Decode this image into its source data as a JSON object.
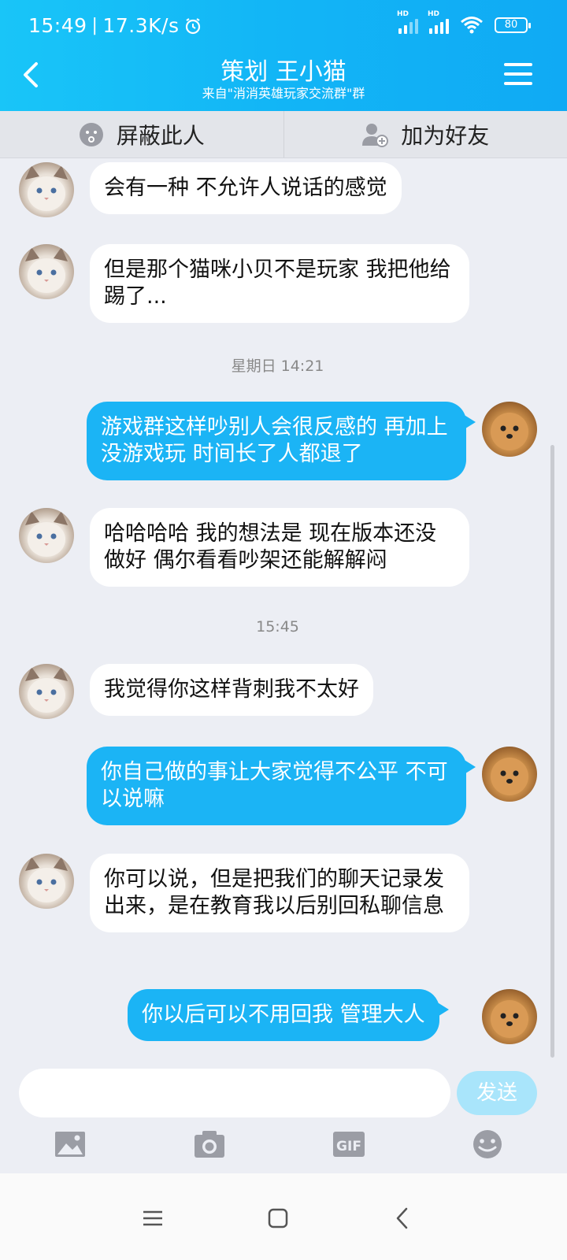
{
  "status": {
    "time": "15:49",
    "speed": "17.3K/s",
    "battery": "80",
    "hd1": "HD",
    "hd2": "HD"
  },
  "header": {
    "title": "策划 王小猫",
    "subtitle": "来自\"消消英雄玩家交流群\"群"
  },
  "actions": {
    "block_label": "屏蔽此人",
    "add_friend_label": "加为好友"
  },
  "messages": [
    {
      "side": "left",
      "text": "会有一种 不允许人说话的感觉"
    },
    {
      "side": "left",
      "text": "但是那个猫咪小贝不是玩家 我把他给踢了..."
    },
    {
      "side": "right",
      "text": "游戏群这样吵别人会很反感的 再加上没游戏玩 时间长了人都退了"
    },
    {
      "side": "left",
      "text": "哈哈哈哈 我的想法是 现在版本还没做好 偶尔看看吵架还能解解闷"
    },
    {
      "side": "left",
      "text": "我觉得你这样背刺我不太好"
    },
    {
      "side": "right",
      "text": "你自己做的事让大家觉得不公平 不可以说嘛"
    },
    {
      "side": "left",
      "text": "你可以说，但是把我们的聊天记录发出来，是在教育我以后别回私聊信息"
    },
    {
      "side": "right",
      "text": "你以后可以不用回我 管理大人"
    }
  ],
  "timestamps": [
    "星期日 14:21",
    "15:45"
  ],
  "input": {
    "placeholder": "",
    "send_label": "发送"
  },
  "colors": {
    "accent": "#12b5f6",
    "bubble_right": "#1bb4f5",
    "send_disabled": "#a9e5fb"
  }
}
